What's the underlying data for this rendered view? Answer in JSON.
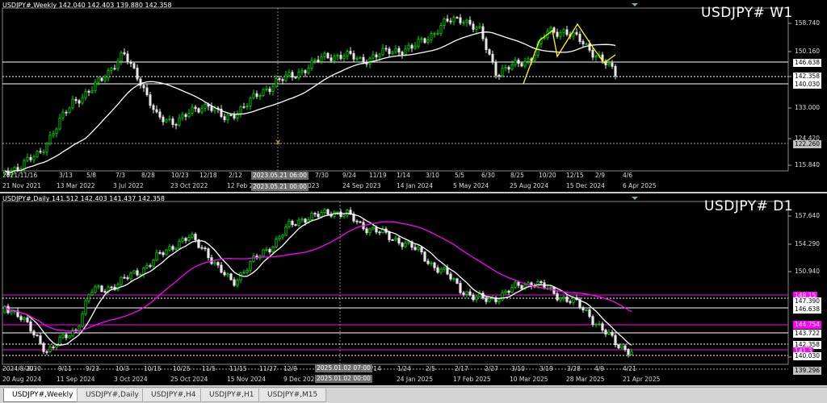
{
  "pane_w1": {
    "header": "USDJPY#,Weekly  142.040 142.403 139.880 142.358",
    "big_label": "USDJPY# W1",
    "price_ticks": [
      "158.740",
      "150.160",
      "142.358",
      "133.000",
      "124.420",
      "115.840"
    ],
    "price_tags": [
      {
        "text": "146.638",
        "bg": "#ffffff",
        "fg": "#000000"
      },
      {
        "text": "142.358",
        "bg": "#ffffff",
        "fg": "#000000"
      },
      {
        "text": "140.030",
        "bg": "#ffffff",
        "fg": "#000000"
      },
      {
        "text": "122.260",
        "bg": "#bfbfbf",
        "fg": "#000000"
      }
    ],
    "time_ticks_top": [
      "2021/11/16",
      "3/13",
      "5/8",
      "7/3",
      "8/28",
      "10/23",
      "12/18",
      "2/12",
      "7/30",
      "9/24",
      "11/19",
      "1/14",
      "3/10",
      "5/5",
      "6/30",
      "8/25",
      "10/20",
      "12/15",
      "2/9",
      "4/6"
    ],
    "time_ticks_bottom": [
      "21 Nov 2021",
      "13 Mar 2022",
      "3 Jul 2022",
      "23 Oct 2022",
      "12 Feb 2",
      "023",
      "24 Sep 2023",
      "14 Jan 2024",
      "5 May 2024",
      "25 Aug 2024",
      "15 Dec 2024",
      "6 Apr 2025"
    ],
    "crosshair_top": "2023.05.21 06:00",
    "crosshair_bottom": "2023.05.21 00:00"
  },
  "pane_d1": {
    "header": "USDJPY#,Daily  141.512 142.403 141.437 142.358",
    "big_label": "USDJPY# D1",
    "price_ticks": [
      "157.640",
      "154.290",
      "150.940",
      "140.890"
    ],
    "price_tags": [
      {
        "text": "148.15",
        "bg": "#ff00ff",
        "fg": "#ffffff"
      },
      {
        "text": "147.390",
        "bg": "#ffffff",
        "fg": "#000000"
      },
      {
        "text": "146.638",
        "bg": "#ffffff",
        "fg": "#000000"
      },
      {
        "text": "144.754",
        "bg": "#ff00ff",
        "fg": "#ffffff"
      },
      {
        "text": "143.722",
        "bg": "#ffffff",
        "fg": "#000000"
      },
      {
        "text": "142.358",
        "bg": "#ffffff",
        "fg": "#000000"
      },
      {
        "text": "141.3",
        "bg": "#ff00ff",
        "fg": "#ffffff"
      },
      {
        "text": "140.030",
        "bg": "#ffffff",
        "fg": "#000000"
      },
      {
        "text": "139.296",
        "bg": "#bfbfbf",
        "fg": "#000000"
      }
    ],
    "time_ticks_top": [
      "2024/8/20",
      "8/30",
      "9/11",
      "9/23",
      "10/3",
      "10/15",
      "10/25",
      "11/5",
      "11/15",
      "11/27",
      "12/9",
      "1/14",
      "1/24",
      "2/5",
      "2/17",
      "2/27",
      "3/10",
      "3/19",
      "3/28",
      "4/9",
      "4/21"
    ],
    "time_ticks_bottom": [
      "20 Aug 2024",
      "11 Sep 2024",
      "3 Oct 2024",
      "25 Oct 2024",
      "15 Nov 2024",
      "9 Dec 2024",
      "5",
      "24 Jan 2025",
      "17 Feb 2025",
      "10 Mar 2025",
      "28 Mar 2025",
      "21 Apr 2025"
    ],
    "crosshair_top": "2025.01.02 07:00",
    "crosshair_bottom": "2025.01.02 00:00"
  },
  "tabs": [
    "USDJPY#,Weekly",
    "USDJPY#,Daily",
    "USDJPY#,H4",
    "USDJPY#,H1",
    "USDJPY#,M15"
  ],
  "active_tab": 0,
  "colors": {
    "bull": "#00dd00",
    "bear": "#e8e8e8",
    "ma_w1": "#ffffff",
    "zigzag": "#ffff00",
    "ma_fast_d1": "#ffffff",
    "ma_slow_d1": "#ff00ff",
    "grid": "#555555"
  }
}
